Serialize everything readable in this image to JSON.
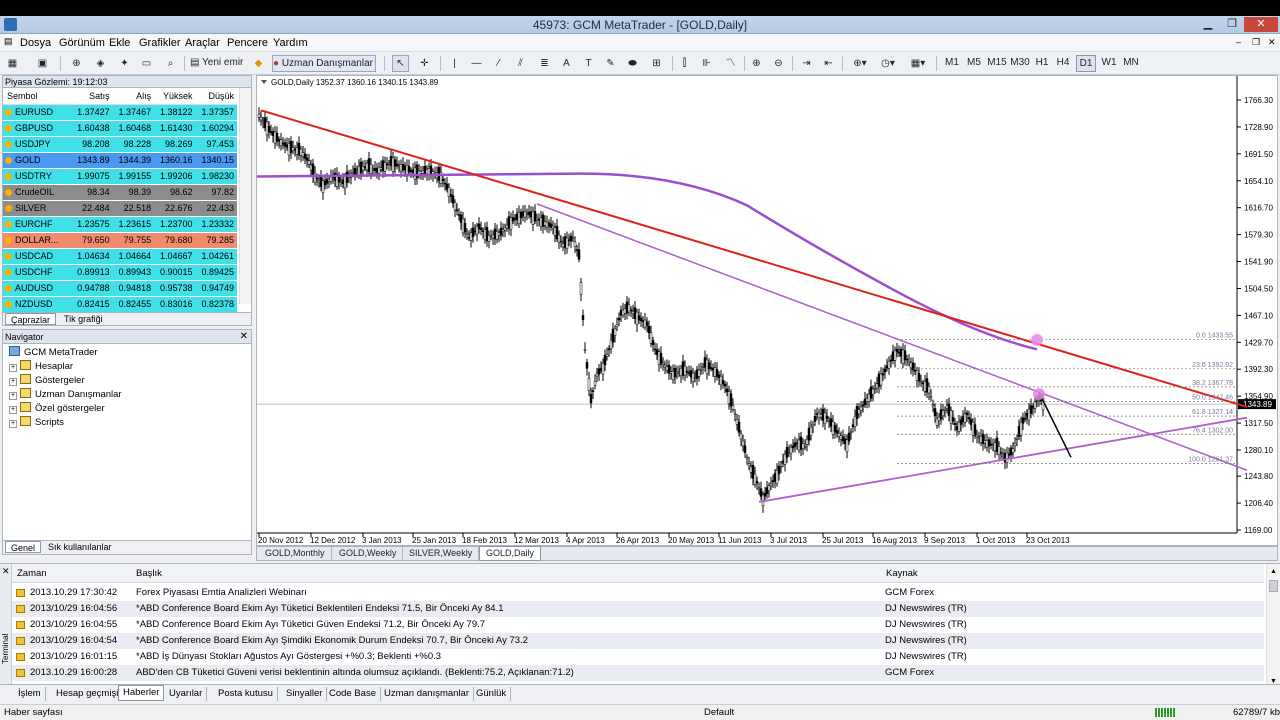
{
  "title": "45973: GCM MetaTrader - [GOLD,Daily]",
  "menu": [
    "Dosya",
    "Görünüm",
    "Ekle",
    "Grafikler",
    "Araçlar",
    "Pencere",
    "Yardım"
  ],
  "toolbar": {
    "new_order": "Yeni emir",
    "expert_advisors": "Uzman Danışmanlar",
    "timeframes": [
      "M1",
      "M5",
      "M15",
      "M30",
      "H1",
      "H4",
      "D1",
      "W1",
      "MN"
    ],
    "active_timeframe": "D1"
  },
  "market_watch": {
    "header": "Piyasa Gözlemi: 19:12:03",
    "columns": [
      "Sembol",
      "Satış",
      "Alış",
      "Yüksek",
      "Düşük"
    ],
    "rows": [
      {
        "s": "EURUSD",
        "bid": "1.37427",
        "ask": "1.37467",
        "high": "1.38122",
        "low": "1.37357",
        "bg": "#3fe0e8"
      },
      {
        "s": "GBPUSD",
        "bid": "1.60438",
        "ask": "1.60468",
        "high": "1.61430",
        "low": "1.60294",
        "bg": "#3fe0e8"
      },
      {
        "s": "USDJPY",
        "bid": "98.208",
        "ask": "98.228",
        "high": "98.269",
        "low": "97.453",
        "bg": "#3fe0e8"
      },
      {
        "s": "GOLD",
        "bid": "1343.89",
        "ask": "1344.39",
        "high": "1360.16",
        "low": "1340.15",
        "bg": "#4a98f0"
      },
      {
        "s": "USDTRY",
        "bid": "1.99075",
        "ask": "1.99155",
        "high": "1.99206",
        "low": "1.98230",
        "bg": "#3fe0e8"
      },
      {
        "s": "CrudeOIL",
        "bid": "98.34",
        "ask": "98.39",
        "high": "98.62",
        "low": "97.82",
        "bg": "#8c8c8c"
      },
      {
        "s": "SILVER",
        "bid": "22.484",
        "ask": "22.518",
        "high": "22.676",
        "low": "22.433",
        "bg": "#8c8c8c"
      },
      {
        "s": "EURCHF",
        "bid": "1.23575",
        "ask": "1.23615",
        "high": "1.23700",
        "low": "1.23332",
        "bg": "#3fe0e8"
      },
      {
        "s": "DOLLAR...",
        "bid": "79.650",
        "ask": "79.755",
        "high": "79.680",
        "low": "79.285",
        "bg": "#f08c6c"
      },
      {
        "s": "USDCAD",
        "bid": "1.04634",
        "ask": "1.04664",
        "high": "1.04667",
        "low": "1.04261",
        "bg": "#3fe0e8"
      },
      {
        "s": "USDCHF",
        "bid": "0.89913",
        "ask": "0.89943",
        "high": "0.90015",
        "low": "0.89425",
        "bg": "#3fe0e8"
      },
      {
        "s": "AUDUSD",
        "bid": "0.94788",
        "ask": "0.94818",
        "high": "0.95738",
        "low": "0.94749",
        "bg": "#3fe0e8"
      },
      {
        "s": "NZDUSD",
        "bid": "0.82415",
        "ask": "0.82455",
        "high": "0.83016",
        "low": "0.82378",
        "bg": "#3fe0e8"
      }
    ],
    "tabs": [
      "Çaprazlar",
      "Tik grafiği"
    ]
  },
  "navigator": {
    "header": "Navigator",
    "root": "GCM MetaTrader",
    "items": [
      "Hesaplar",
      "Göstergeler",
      "Uzman Danışmanlar",
      "Özel göstergeler",
      "Scripts"
    ],
    "tabs": [
      "Genel",
      "Sık kullanılanlar"
    ]
  },
  "chart": {
    "info": "GOLD,Daily  1352.37 1360.16 1340.15 1343.89",
    "price_labels": [
      "1766.30",
      "1728.90",
      "1691.50",
      "1654.10",
      "1616.70",
      "1579.30",
      "1541.90",
      "1504.50",
      "1467.10",
      "1429.70",
      "1392.30",
      "1354.90",
      "1317.50",
      "1280.10",
      "1243.80",
      "1206.40",
      "1169.00"
    ],
    "current_price": "1343.89",
    "date_labels": [
      "20 Nov 2012",
      "12 Dec 2012",
      "3 Jan 2013",
      "25 Jan 2013",
      "18 Feb 2013",
      "12 Mar 2013",
      "4 Apr 2013",
      "26 Apr 2013",
      "20 May 2013",
      "11 Jun 2013",
      "3 Jul 2013",
      "25 Jul 2013",
      "16 Aug 2013",
      "9 Sep 2013",
      "1 Oct 2013",
      "23 Oct 2013"
    ],
    "fib_labels": [
      "0.0 1433.55",
      "23.6 1392.92",
      "38.2 1367.78",
      "50.0 1347.46",
      "61.8 1327.14",
      "76.4 1302.00",
      "100.0 1261.37"
    ],
    "tabs": [
      "GOLD,Monthly",
      "GOLD,Weekly",
      "SILVER,Weekly",
      "GOLD,Daily"
    ],
    "active_tab": "GOLD,Daily"
  },
  "terminal": {
    "columns": [
      "Zaman",
      "Başlık",
      "Kaynak"
    ],
    "rows": [
      {
        "t": "2013.10.29 17:30:42",
        "h": "Forex Piyasası Emtia Analizleri Webinarı",
        "k": "GCM Forex"
      },
      {
        "t": "2013/10/29 16:04:56",
        "h": "*ABD Conference Board Ekim Ayı Tüketici Beklentileri Endeksi 71.5, Bir Önceki Ay 84.1",
        "k": "DJ Newswires (TR)"
      },
      {
        "t": "2013/10/29 16:04:55",
        "h": "*ABD Conference Board Ekim Ayı Tüketici Güven Endeksi 71.2, Bir Önceki Ay 79.7",
        "k": "DJ Newswires (TR)"
      },
      {
        "t": "2013/10/29 16:04:54",
        "h": "*ABD Conference Board Ekim Ayı Şimdiki Ekonomik Durum Endeksi 70.7, Bir Önceki Ay 73.2",
        "k": "DJ Newswires (TR)"
      },
      {
        "t": "2013/10/29 16:01:15",
        "h": "*ABD İş Dünyası Stokları Ağustos Ayı Göstergesi +%0.3; Beklenti +%0.3",
        "k": "DJ Newswires (TR)"
      },
      {
        "t": "2013.10.29 16:00:28",
        "h": "ABD'den CB Tüketici Güveni verisi beklentinin altında olumsuz açıklandı. (Beklenti:75.2, Açıklanan:71.2)",
        "k": "GCM Forex"
      }
    ],
    "side_label": "Terminal",
    "tabs": [
      "İşlem",
      "Hesap geçmişi",
      "Haberler",
      "Uyarılar",
      "Posta kutusu",
      "Sinyaller",
      "Code Base",
      "Uzman danışmanlar",
      "Günlük"
    ],
    "active_tab": "Haberler"
  },
  "status": {
    "left": "Haber sayfası",
    "middle": "Default",
    "right": "62789/7 kb"
  }
}
